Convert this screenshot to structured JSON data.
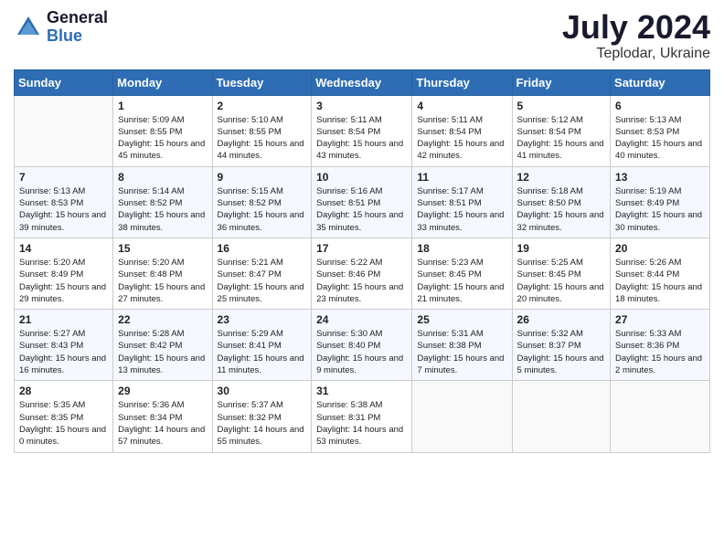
{
  "logo": {
    "general": "General",
    "blue": "Blue"
  },
  "title": {
    "month_year": "July 2024",
    "location": "Teplodar, Ukraine"
  },
  "days_of_week": [
    "Sunday",
    "Monday",
    "Tuesday",
    "Wednesday",
    "Thursday",
    "Friday",
    "Saturday"
  ],
  "weeks": [
    [
      {
        "day": "",
        "sunrise": "",
        "sunset": "",
        "daylight": ""
      },
      {
        "day": "1",
        "sunrise": "5:09 AM",
        "sunset": "8:55 PM",
        "daylight": "15 hours and 45 minutes."
      },
      {
        "day": "2",
        "sunrise": "5:10 AM",
        "sunset": "8:55 PM",
        "daylight": "15 hours and 44 minutes."
      },
      {
        "day": "3",
        "sunrise": "5:11 AM",
        "sunset": "8:54 PM",
        "daylight": "15 hours and 43 minutes."
      },
      {
        "day": "4",
        "sunrise": "5:11 AM",
        "sunset": "8:54 PM",
        "daylight": "15 hours and 42 minutes."
      },
      {
        "day": "5",
        "sunrise": "5:12 AM",
        "sunset": "8:54 PM",
        "daylight": "15 hours and 41 minutes."
      },
      {
        "day": "6",
        "sunrise": "5:13 AM",
        "sunset": "8:53 PM",
        "daylight": "15 hours and 40 minutes."
      }
    ],
    [
      {
        "day": "7",
        "sunrise": "5:13 AM",
        "sunset": "8:53 PM",
        "daylight": "15 hours and 39 minutes."
      },
      {
        "day": "8",
        "sunrise": "5:14 AM",
        "sunset": "8:52 PM",
        "daylight": "15 hours and 38 minutes."
      },
      {
        "day": "9",
        "sunrise": "5:15 AM",
        "sunset": "8:52 PM",
        "daylight": "15 hours and 36 minutes."
      },
      {
        "day": "10",
        "sunrise": "5:16 AM",
        "sunset": "8:51 PM",
        "daylight": "15 hours and 35 minutes."
      },
      {
        "day": "11",
        "sunrise": "5:17 AM",
        "sunset": "8:51 PM",
        "daylight": "15 hours and 33 minutes."
      },
      {
        "day": "12",
        "sunrise": "5:18 AM",
        "sunset": "8:50 PM",
        "daylight": "15 hours and 32 minutes."
      },
      {
        "day": "13",
        "sunrise": "5:19 AM",
        "sunset": "8:49 PM",
        "daylight": "15 hours and 30 minutes."
      }
    ],
    [
      {
        "day": "14",
        "sunrise": "5:20 AM",
        "sunset": "8:49 PM",
        "daylight": "15 hours and 29 minutes."
      },
      {
        "day": "15",
        "sunrise": "5:20 AM",
        "sunset": "8:48 PM",
        "daylight": "15 hours and 27 minutes."
      },
      {
        "day": "16",
        "sunrise": "5:21 AM",
        "sunset": "8:47 PM",
        "daylight": "15 hours and 25 minutes."
      },
      {
        "day": "17",
        "sunrise": "5:22 AM",
        "sunset": "8:46 PM",
        "daylight": "15 hours and 23 minutes."
      },
      {
        "day": "18",
        "sunrise": "5:23 AM",
        "sunset": "8:45 PM",
        "daylight": "15 hours and 21 minutes."
      },
      {
        "day": "19",
        "sunrise": "5:25 AM",
        "sunset": "8:45 PM",
        "daylight": "15 hours and 20 minutes."
      },
      {
        "day": "20",
        "sunrise": "5:26 AM",
        "sunset": "8:44 PM",
        "daylight": "15 hours and 18 minutes."
      }
    ],
    [
      {
        "day": "21",
        "sunrise": "5:27 AM",
        "sunset": "8:43 PM",
        "daylight": "15 hours and 16 minutes."
      },
      {
        "day": "22",
        "sunrise": "5:28 AM",
        "sunset": "8:42 PM",
        "daylight": "15 hours and 13 minutes."
      },
      {
        "day": "23",
        "sunrise": "5:29 AM",
        "sunset": "8:41 PM",
        "daylight": "15 hours and 11 minutes."
      },
      {
        "day": "24",
        "sunrise": "5:30 AM",
        "sunset": "8:40 PM",
        "daylight": "15 hours and 9 minutes."
      },
      {
        "day": "25",
        "sunrise": "5:31 AM",
        "sunset": "8:38 PM",
        "daylight": "15 hours and 7 minutes."
      },
      {
        "day": "26",
        "sunrise": "5:32 AM",
        "sunset": "8:37 PM",
        "daylight": "15 hours and 5 minutes."
      },
      {
        "day": "27",
        "sunrise": "5:33 AM",
        "sunset": "8:36 PM",
        "daylight": "15 hours and 2 minutes."
      }
    ],
    [
      {
        "day": "28",
        "sunrise": "5:35 AM",
        "sunset": "8:35 PM",
        "daylight": "15 hours and 0 minutes."
      },
      {
        "day": "29",
        "sunrise": "5:36 AM",
        "sunset": "8:34 PM",
        "daylight": "14 hours and 57 minutes."
      },
      {
        "day": "30",
        "sunrise": "5:37 AM",
        "sunset": "8:32 PM",
        "daylight": "14 hours and 55 minutes."
      },
      {
        "day": "31",
        "sunrise": "5:38 AM",
        "sunset": "8:31 PM",
        "daylight": "14 hours and 53 minutes."
      },
      {
        "day": "",
        "sunrise": "",
        "sunset": "",
        "daylight": ""
      },
      {
        "day": "",
        "sunrise": "",
        "sunset": "",
        "daylight": ""
      },
      {
        "day": "",
        "sunrise": "",
        "sunset": "",
        "daylight": ""
      }
    ]
  ]
}
